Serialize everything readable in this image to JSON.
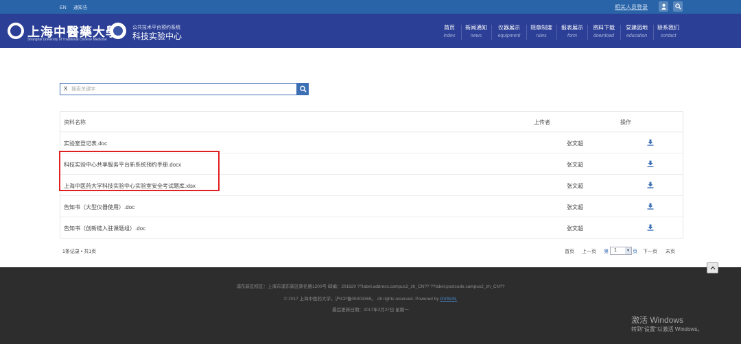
{
  "topbar": {
    "links": [
      "EN",
      "通知告"
    ],
    "search_link": "相关人员登录",
    "bg_color": "#2a64a8"
  },
  "header": {
    "logo_text": "上海中醫藥大學",
    "logo_en": "Shanghai University of Traditional Chinese Medicine",
    "system_small": "公共技术平台预约系统",
    "system_title": "科技实验中心",
    "bg_color": "#2b3f96"
  },
  "nav": [
    {
      "cn": "首页",
      "en": "index"
    },
    {
      "cn": "新闻通知",
      "en": "news"
    },
    {
      "cn": "仪器展示",
      "en": "equipment"
    },
    {
      "cn": "规章制度",
      "en": "rules"
    },
    {
      "cn": "报表展示",
      "en": "form"
    },
    {
      "cn": "资料下载",
      "en": "download"
    },
    {
      "cn": "党建园地",
      "en": "education"
    },
    {
      "cn": "联系我们",
      "en": "contact"
    }
  ],
  "search": {
    "clear_label": "X",
    "placeholder": "搜索关键字",
    "accent_color": "#3c6fb4"
  },
  "table": {
    "headers": {
      "name": "资料名称",
      "uploader": "上传者",
      "action": "操作"
    },
    "rows": [
      {
        "name": "实验室登记表.doc",
        "uploader": "张文超"
      },
      {
        "name": "科技实验中心共享服务平台新系统预约手册.docx",
        "uploader": "张文超"
      },
      {
        "name": "上海中医药大学科技实验中心实验室安全考试题库.xlsx",
        "uploader": "张文超"
      },
      {
        "name": "告知书（大型仪器使用）.doc",
        "uploader": "张文超"
      },
      {
        "name": "告知书（创新链入驻课题组）.doc",
        "uploader": "张文超"
      }
    ],
    "download_icon": "download-icon"
  },
  "pagination": {
    "record_count": "1条记录 • 共1页",
    "first": "首页",
    "prev": "上一页",
    "before_select": "第",
    "current_page": "1",
    "after_select": "页",
    "next": "下一页",
    "last": "末页"
  },
  "footer": {
    "line1": "浦东新区校区：上海市浦东新区蔡伦路1200号    邮编：201620    ??label.address.campus2_zh_CN??    ??label.postcode.campus2_zh_CN??",
    "line2_prefix": "© 2017 上海中医药大学。沪ICP备05003365。   All rights reserved.   Powered by ",
    "line2_link": "GVSUN.",
    "line3": "最后更新日期：2017年2月27日    星期一",
    "bg_color": "#2d2d2d"
  },
  "windows_watermark": {
    "line1": "激活 Windows",
    "line2": "转到\"设置\"以激活 Windows。"
  }
}
